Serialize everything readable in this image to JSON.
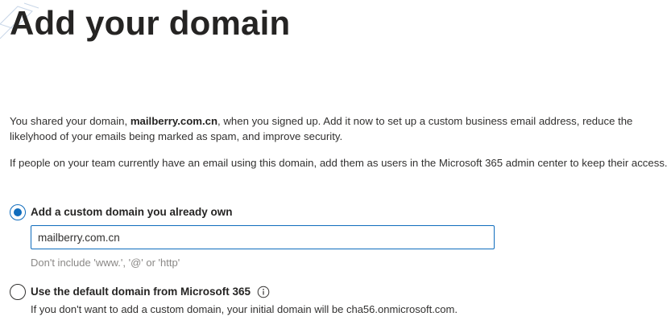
{
  "page": {
    "title": "Add your domain",
    "intro": {
      "before": "You shared your domain, ",
      "domain": "mailberry.com.cn",
      "after": ", when you signed up. Add it now to set up a custom business email address, reduce the likelyhood of your emails being marked as spam, and improve security."
    },
    "team_note": "If people on your team currently have an email using this domain, add them as users in the Microsoft 365 admin center to keep their access."
  },
  "options": {
    "custom": {
      "label": "Add a custom domain you already own",
      "selected": true,
      "input_value": "mailberry.com.cn",
      "hint": "Don't include 'www.', '@' or 'http'"
    },
    "default": {
      "label": "Use the default domain from Microsoft 365",
      "selected": false,
      "icon": "info-icon",
      "description": "If you don't want to add a custom domain, your initial domain will be cha56.onmicrosoft.com."
    }
  },
  "colors": {
    "accent": "#0f6cbd",
    "text": "#323130",
    "hint": "#8a8886"
  }
}
